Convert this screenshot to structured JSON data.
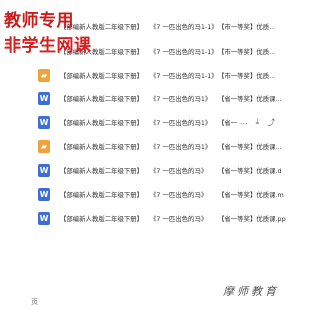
{
  "watermark": {
    "line1": "教师专用",
    "line2": "非学生网课",
    "bottom": "摩师教育"
  },
  "corner_label": "页",
  "rows": [
    {
      "icon": "pdf-icon",
      "type": "pdf",
      "col_a": "【部编新人教版二年级下册】",
      "col_b": "《7 一匹出色的马1-1》",
      "col_c": "【市一等奖】优质...",
      "show_icon": false
    },
    {
      "icon": "pdf-icon",
      "type": "pdf",
      "col_a": "【部编新人教版二年级下册】",
      "col_b": "《7 一匹出色的马1-1》",
      "col_c": "【市一等奖】优质...",
      "show_icon": false
    },
    {
      "icon": "pdf-icon",
      "type": "pdf",
      "col_a": "【部编新人教版二年级下册】",
      "col_b": "《7 一匹出色的马1-1》",
      "col_c": "【市一等奖】优质...",
      "show_icon": true
    },
    {
      "icon": "doc-icon",
      "type": "doc",
      "col_a": "【部编新人教版二年级下册】",
      "col_b": "《7 一匹出色的马1》",
      "col_c": "【省一等奖】优质课...",
      "show_icon": true
    },
    {
      "icon": "doc-icon",
      "type": "doc",
      "col_a": "【部编新人教版二年级下册】",
      "col_b": "《7 一匹出色的马1》",
      "col_c": "【省一",
      "show_icon": true,
      "has_actions": true
    },
    {
      "icon": "pdf-icon",
      "type": "pdf",
      "col_a": "【部编新人教版二年级下册】",
      "col_b": "《7 一匹出色的马1》",
      "col_c": "【省一等奖】优质课...",
      "show_icon": true
    },
    {
      "icon": "doc-icon",
      "type": "doc",
      "col_a": "【部编新人教版二年级下册】",
      "col_b": "《7 一匹出色的马》",
      "col_c": "【省一等奖】优质课.d",
      "show_icon": true
    },
    {
      "icon": "doc-icon",
      "type": "doc",
      "col_a": "【部编新人教版二年级下册】",
      "col_b": "《7 一匹出色的马》",
      "col_c": "【省一等奖】优质课.m",
      "show_icon": true
    },
    {
      "icon": "doc-icon",
      "type": "doc",
      "col_a": "【部编新人教版二年级下册】",
      "col_b": "《7 一匹出色的马》",
      "col_c": "【省一等奖】优质课.pp",
      "show_icon": true
    }
  ],
  "row_actions": {
    "more": "...",
    "download": "⤓",
    "share": "⤴"
  },
  "colors": {
    "pdf": "#f0a33a",
    "doc": "#3f6fd6",
    "watermark_red": "#c81e1e"
  }
}
